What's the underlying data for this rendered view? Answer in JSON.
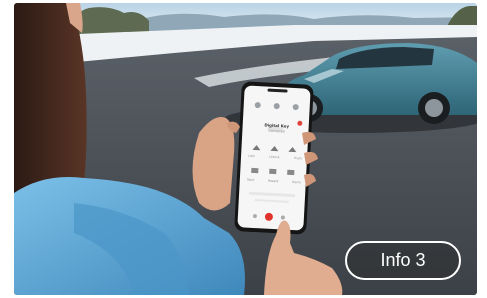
{
  "scene": {
    "description_icon": "photo-woman-using-phone-app-near-car"
  },
  "phone_screen": {
    "title": "Digital Key",
    "subtitle": "Connected",
    "row1": [
      "Lock",
      "Unlock",
      "Trunk"
    ],
    "row2": [
      "Start",
      "Hazard",
      "Alarm"
    ]
  },
  "info_button": {
    "label": "Info 3"
  },
  "colors": {
    "car": "#3f7f93",
    "sky": "#c9dcea",
    "asphalt": "#4a4f55",
    "jacket": "#5aa7d6",
    "button_border": "#ffffff"
  }
}
